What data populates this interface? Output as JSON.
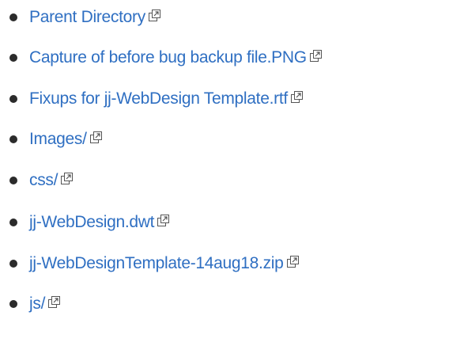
{
  "listing": {
    "items": [
      {
        "label": "Parent Directory",
        "icon": "external-link-icon"
      },
      {
        "label": "Capture of before bug backup file.PNG",
        "icon": "external-link-icon"
      },
      {
        "label": "Fixups for jj-WebDesign Template.rtf",
        "icon": "external-link-icon"
      },
      {
        "label": "Images/",
        "icon": "external-link-icon"
      },
      {
        "label": "css/",
        "icon": "external-link-icon"
      },
      {
        "label": "jj-WebDesign.dwt",
        "icon": "external-link-icon"
      },
      {
        "label": "jj-WebDesignTemplate-14aug18.zip",
        "icon": "external-link-icon"
      },
      {
        "label": "js/",
        "icon": "external-link-icon"
      }
    ]
  },
  "colors": {
    "link": "#2f6fc2",
    "bullet": "#2b2b2b",
    "icon": "#555555"
  }
}
